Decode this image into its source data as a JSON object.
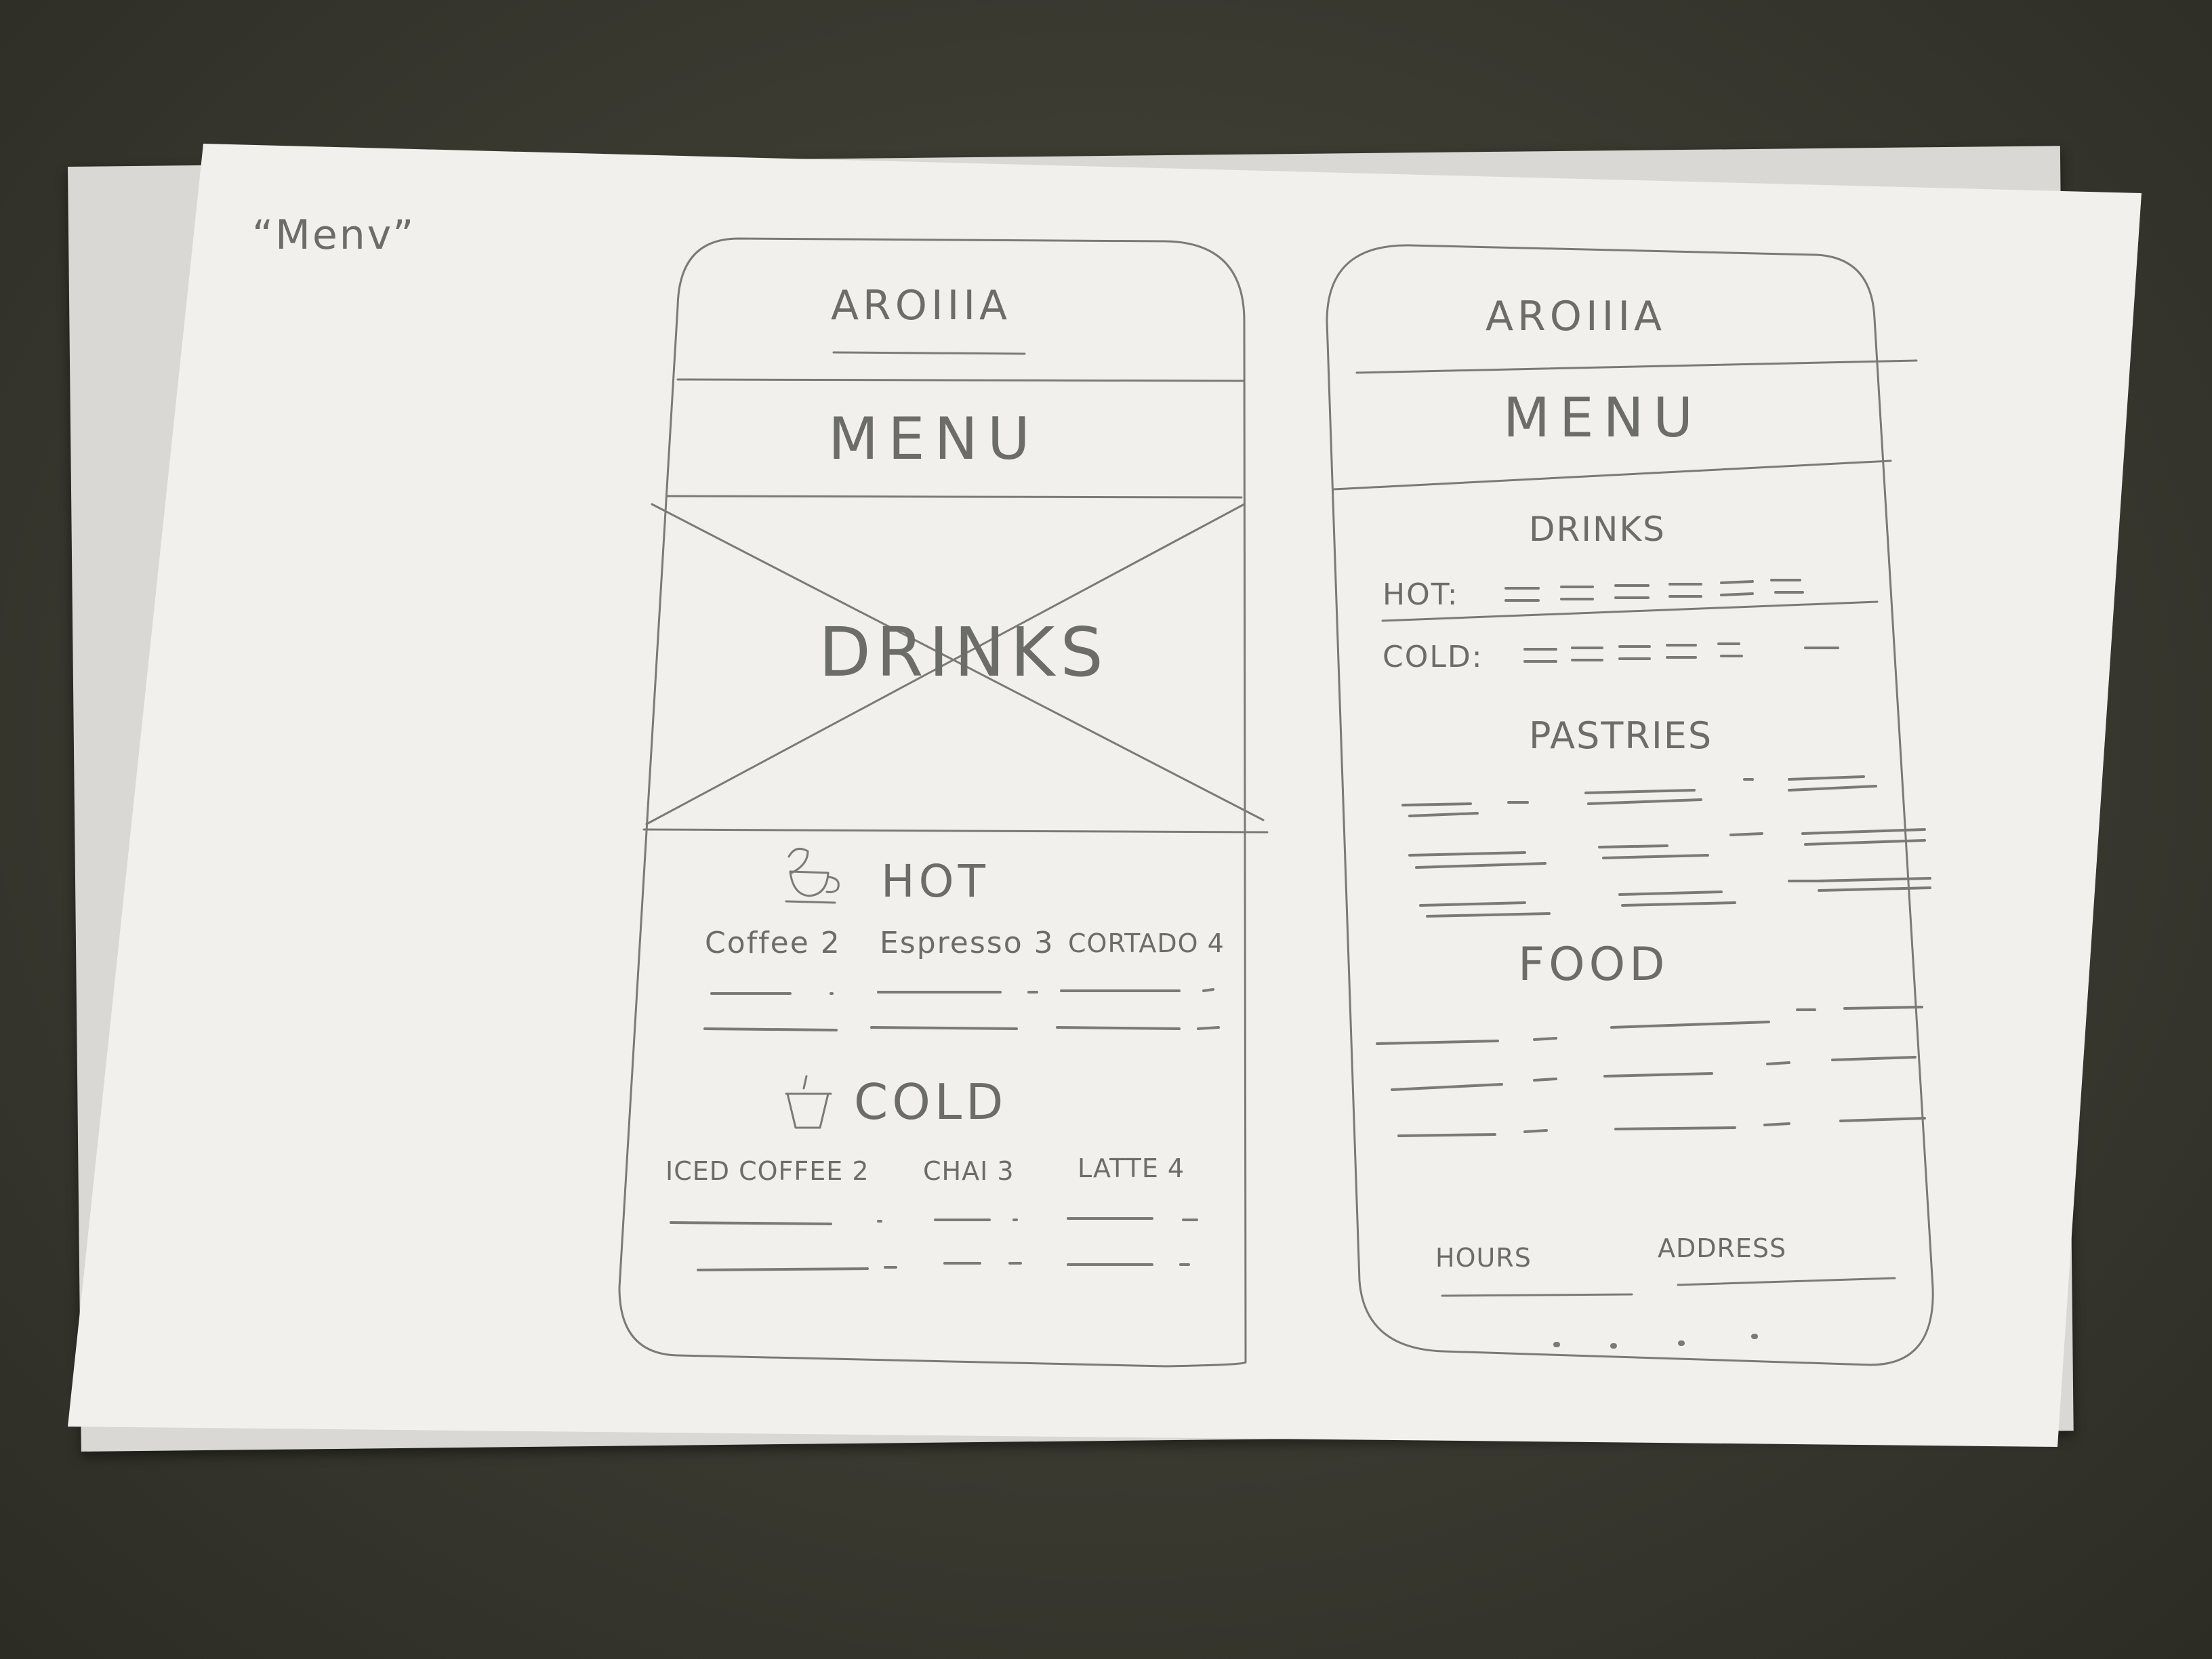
{
  "annotation": {
    "title": "“Menv”"
  },
  "phone_left": {
    "brand": "AROIIIA",
    "header": "MENU",
    "hero_label": "DRINKS",
    "hot": {
      "title": "HOT",
      "icon": "hot-cup-icon",
      "items": [
        "Coffee 2",
        "Espresso 3",
        "CORTADO 4"
      ]
    },
    "cold": {
      "title": "COLD",
      "icon": "iced-cup-icon",
      "items": [
        "ICED COFFEE 2",
        "CHAI 3",
        "LATTE 4"
      ]
    }
  },
  "phone_right": {
    "brand": "AROIIIA",
    "header": "MENU",
    "drinks_title": "DRINKS",
    "hot_label": "HOT:",
    "cold_label": "COLD:",
    "pastries_title": "PASTRIES",
    "food_title": "FOOD",
    "footer": {
      "hours": "HOURS",
      "address": "ADDRESS"
    }
  },
  "colors": {
    "pencil": "#7a7a76",
    "paper": "#f1f0ed",
    "table": "#3a3a31"
  }
}
